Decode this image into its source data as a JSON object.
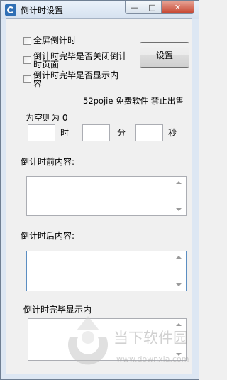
{
  "window": {
    "title": "倒计时设置",
    "min": "—",
    "max": "□",
    "close": "✕"
  },
  "options": {
    "fullscreen": "全屏倒计时",
    "close_page_l1": "倒计时完毕是否关闭倒计",
    "close_page_l2": "时页面",
    "show_content_l1": "倒计时完毕是否显示内",
    "show_content_l2": "容"
  },
  "settings_button": "设置",
  "notice": "52pojie 免费软件 禁止出售",
  "time": {
    "hint": "为空则为 0",
    "hour": "时",
    "minute": "分",
    "second": "秒"
  },
  "before_label": "倒计时前内容:",
  "after_label": "倒计时后内容:",
  "finish_label": "倒计时完毕显示内",
  "watermark": {
    "main": "当下软件园",
    "url": "www.downxia.com"
  }
}
